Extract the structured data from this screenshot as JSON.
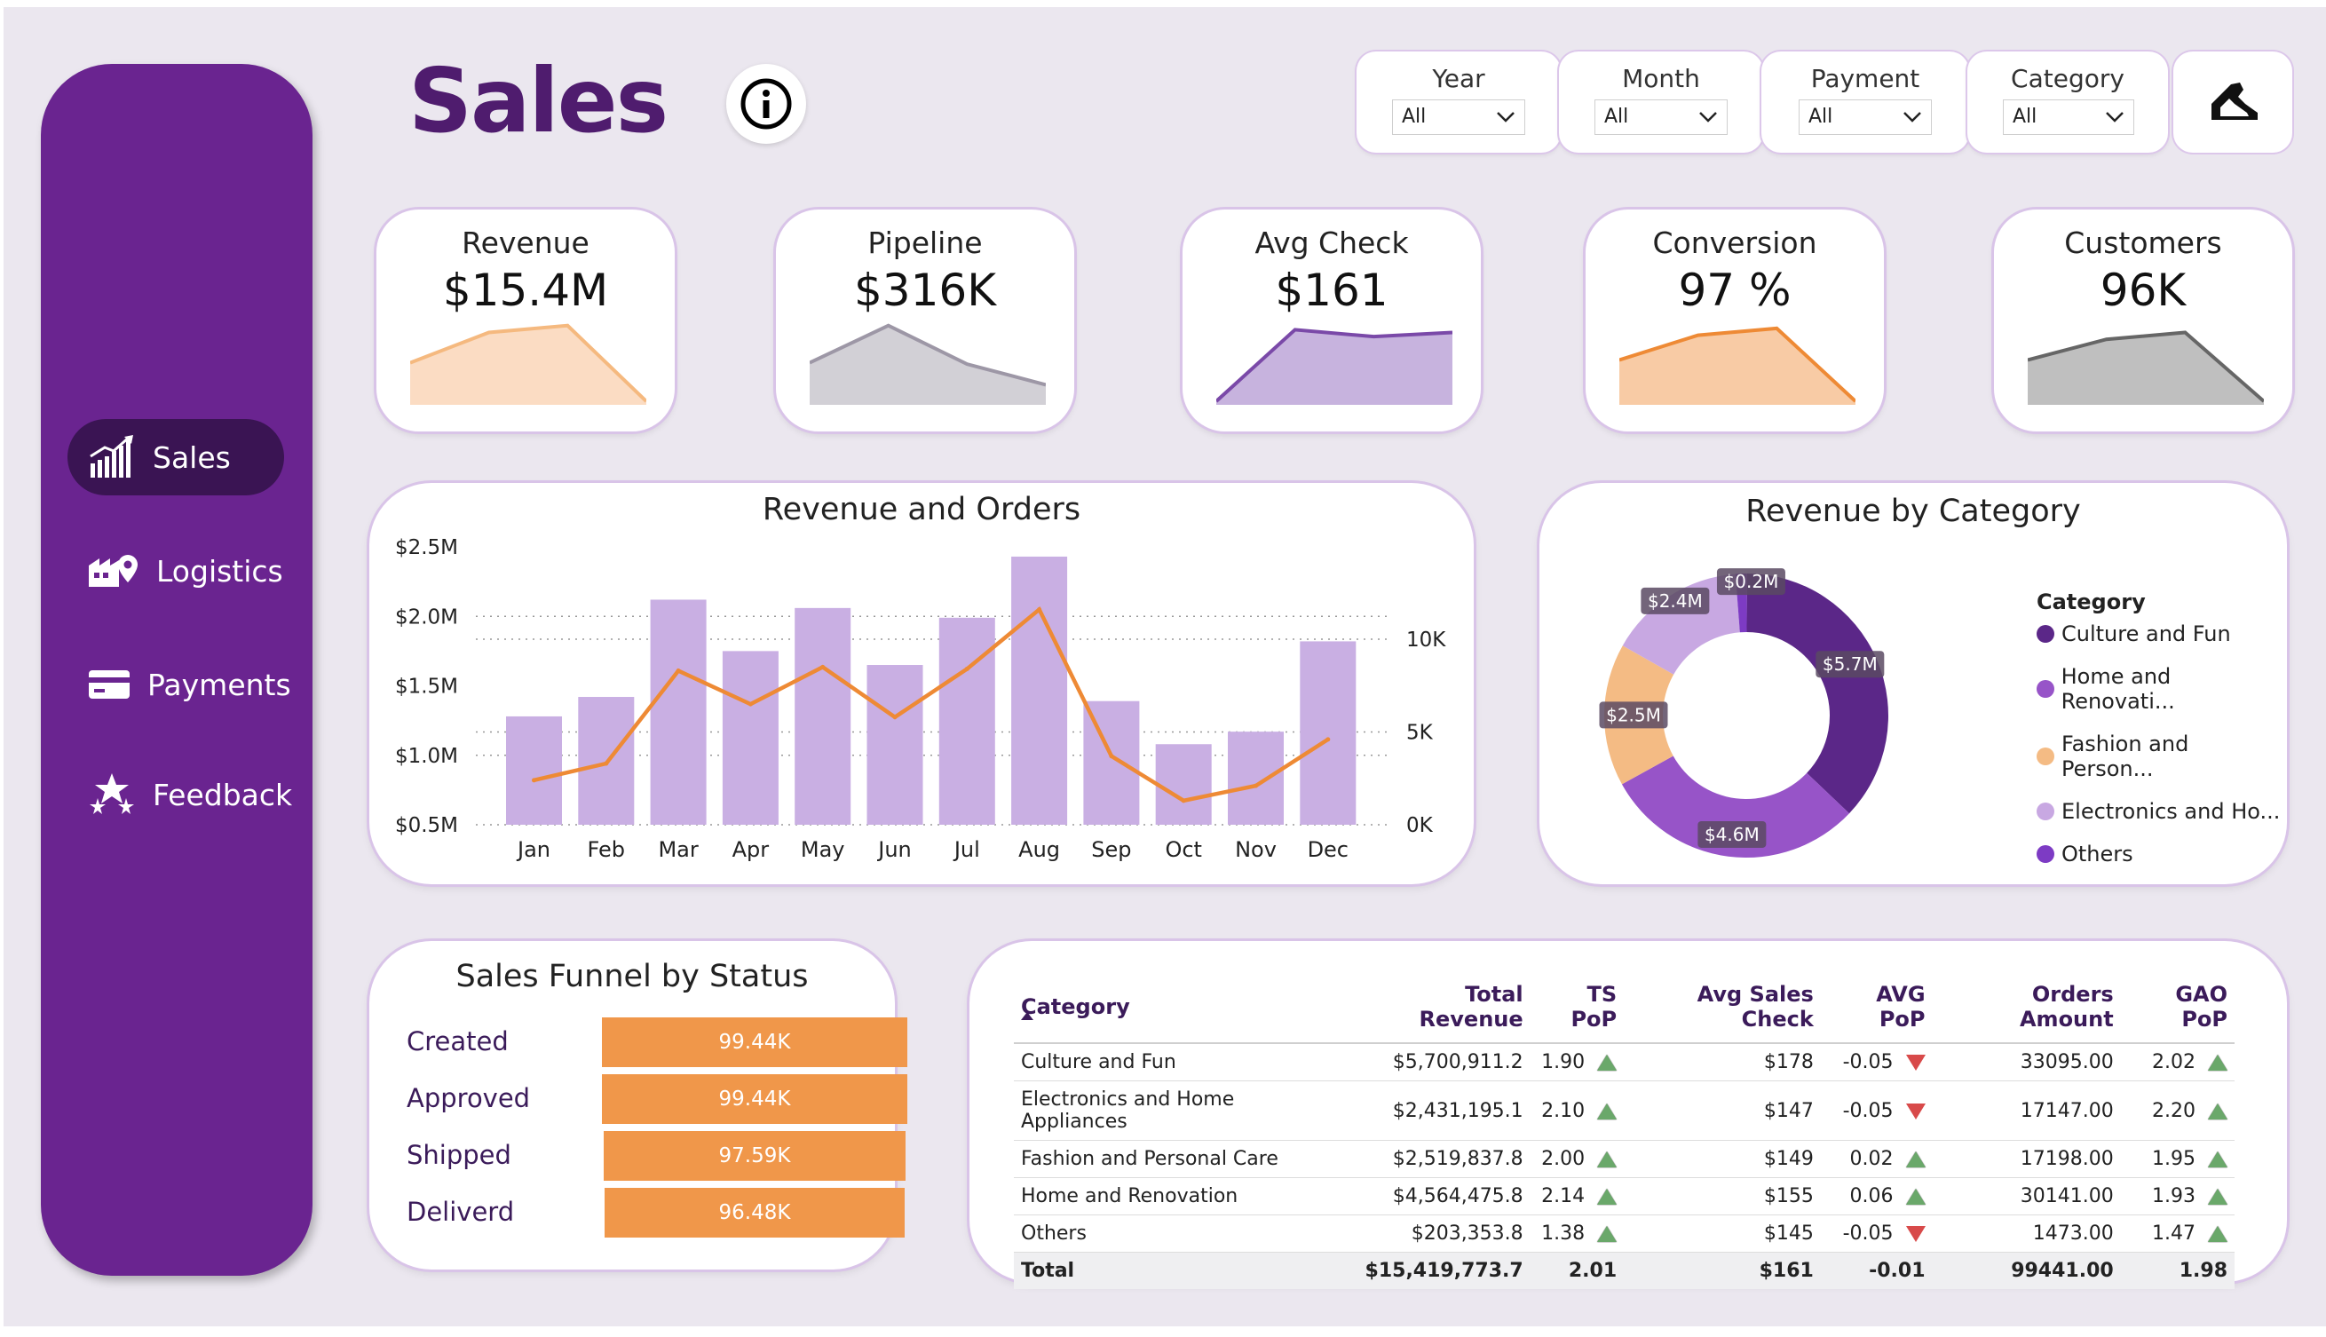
{
  "header": {
    "title": "Sales"
  },
  "filters": [
    {
      "label": "Year",
      "value": "All"
    },
    {
      "label": "Month",
      "value": "All"
    },
    {
      "label": "Payment",
      "value": "All"
    },
    {
      "label": "Category",
      "value": "All"
    }
  ],
  "sidebar": {
    "items": [
      {
        "label": "Sales",
        "icon": "bar-chart-growth-icon",
        "active": true
      },
      {
        "label": "Logistics",
        "icon": "warehouse-location-icon",
        "active": false
      },
      {
        "label": "Payments",
        "icon": "credit-card-icon",
        "active": false
      },
      {
        "label": "Feedback",
        "icon": "stars-icon",
        "active": false
      }
    ]
  },
  "kpis": [
    {
      "title": "Revenue",
      "value": "$15.4M",
      "color": "#f5b97f",
      "fill": "#fbdcc3",
      "trend": [
        0.28,
        0.5,
        0.55,
        0.0
      ]
    },
    {
      "title": "Pipeline",
      "value": "$316K",
      "color": "#9d97a6",
      "fill": "#d2d0d6",
      "trend": [
        0.28,
        0.55,
        0.27,
        0.12
      ]
    },
    {
      "title": "Avg Check",
      "value": "$161",
      "color": "#7a49a8",
      "fill": "#c7b3de",
      "trend": [
        0.0,
        0.52,
        0.47,
        0.5
      ]
    },
    {
      "title": "Conversion",
      "value": "97 %",
      "color": "#ee8a35",
      "fill": "#f8cba5",
      "trend": [
        0.3,
        0.48,
        0.53,
        0.0
      ]
    },
    {
      "title": "Customers",
      "value": "96K",
      "color": "#666666",
      "fill": "#bfbfbf",
      "trend": [
        0.3,
        0.45,
        0.5,
        0.0
      ]
    }
  ],
  "revenue_orders": {
    "title": "Revenue and Orders",
    "y_ticks": [
      "$2.5M",
      "$2.0M",
      "$1.5M",
      "$1.0M",
      "$0.5M"
    ],
    "y2_ticks": [
      "10K",
      "5K",
      "0K"
    ]
  },
  "revenue_by_category": {
    "title": "Revenue by Category",
    "legend_title": "Category",
    "legend_items": [
      "Culture and Fun",
      "Home and Renovati...",
      "Fashion and Person...",
      "Electronics and Ho...",
      "Others"
    ],
    "labels": [
      "$5.7M",
      "$4.6M",
      "$2.5M",
      "$2.4M",
      "$0.2M"
    ]
  },
  "chart_data": [
    {
      "type": "bar",
      "title": "Revenue and Orders",
      "categories": [
        "Jan",
        "Feb",
        "Mar",
        "Apr",
        "May",
        "Jun",
        "Jul",
        "Aug",
        "Sep",
        "Oct",
        "Nov",
        "Dec"
      ],
      "series": [
        {
          "values": [
            1.28,
            1.42,
            2.12,
            1.75,
            2.06,
            1.65,
            1.99,
            2.43,
            1.39,
            1.08,
            1.17,
            1.82
          ],
          "axis": "left",
          "color": "#c9afe3"
        },
        {
          "values": [
            2400,
            3300,
            8300,
            6500,
            8500,
            5800,
            8400,
            11600,
            3700,
            1300,
            2100,
            4600
          ],
          "axis": "right",
          "color": "#ee8a35"
        }
      ],
      "ylim": [
        0.5,
        2.5
      ],
      "y2lim": [
        0,
        10000
      ],
      "grid": true
    },
    {
      "type": "pie",
      "title": "Revenue by Category",
      "categories": [
        "Culture and Fun",
        "Home and Renovation",
        "Fashion and Personal Care",
        "Electronics and Home Appliances",
        "Others"
      ],
      "values": [
        5.7,
        4.6,
        2.5,
        2.4,
        0.2
      ],
      "colors": [
        "#5b2788",
        "#9754c8",
        "#f4bb84",
        "#c8a8e2",
        "#7d3bc4"
      ],
      "legend": "right"
    },
    {
      "type": "bar",
      "title": "Sales Funnel by Status",
      "categories": [
        "Created",
        "Approved",
        "Shipped",
        "Deliverd"
      ],
      "values": [
        99.44,
        99.44,
        97.59,
        96.48
      ],
      "labels": [
        "99.44K",
        "99.44K",
        "97.59K",
        "96.48K"
      ]
    }
  ],
  "funnel": {
    "title": "Sales Funnel by Status",
    "rows": [
      {
        "label": "Created",
        "value": "99.44K",
        "ratio": 1.0
      },
      {
        "label": "Approved",
        "value": "99.44K",
        "ratio": 1.0
      },
      {
        "label": "Shipped",
        "value": "97.59K",
        "ratio": 0.981
      },
      {
        "label": "Deliverd",
        "value": "96.48K",
        "ratio": 0.97
      }
    ]
  },
  "table": {
    "headers": [
      "Category",
      "Total Revenue",
      "TS PoP",
      "Avg Sales Check",
      "AVG PoP",
      "Orders Amount",
      "GAO PoP"
    ],
    "rows": [
      {
        "category": "Culture and Fun",
        "revenue": "$5,700,911.2",
        "ts": "1.90",
        "ts_dir": "up",
        "avg": "$178",
        "avgpop": "-0.05",
        "avg_dir": "down",
        "orders": "33095.00",
        "gao": "2.02",
        "gao_dir": "up"
      },
      {
        "category": "Electronics and Home Appliances",
        "revenue": "$2,431,195.1",
        "ts": "2.10",
        "ts_dir": "up",
        "avg": "$147",
        "avgpop": "-0.05",
        "avg_dir": "down",
        "orders": "17147.00",
        "gao": "2.20",
        "gao_dir": "up"
      },
      {
        "category": "Fashion and Personal Care",
        "revenue": "$2,519,837.8",
        "ts": "2.00",
        "ts_dir": "up",
        "avg": "$149",
        "avgpop": "0.02",
        "avg_dir": "up",
        "orders": "17198.00",
        "gao": "1.95",
        "gao_dir": "up"
      },
      {
        "category": "Home and Renovation",
        "revenue": "$4,564,475.8",
        "ts": "2.14",
        "ts_dir": "up",
        "avg": "$155",
        "avgpop": "0.06",
        "avg_dir": "up",
        "orders": "30141.00",
        "gao": "1.93",
        "gao_dir": "up"
      },
      {
        "category": "Others",
        "revenue": "$203,353.8",
        "ts": "1.38",
        "ts_dir": "up",
        "avg": "$145",
        "avgpop": "-0.05",
        "avg_dir": "down",
        "orders": "1473.00",
        "gao": "1.47",
        "gao_dir": "up"
      }
    ],
    "total": {
      "category": "Total",
      "revenue": "$15,419,773.7",
      "ts": "2.01",
      "avg": "$161",
      "avgpop": "-0.01",
      "orders": "99441.00",
      "gao": "1.98"
    }
  }
}
